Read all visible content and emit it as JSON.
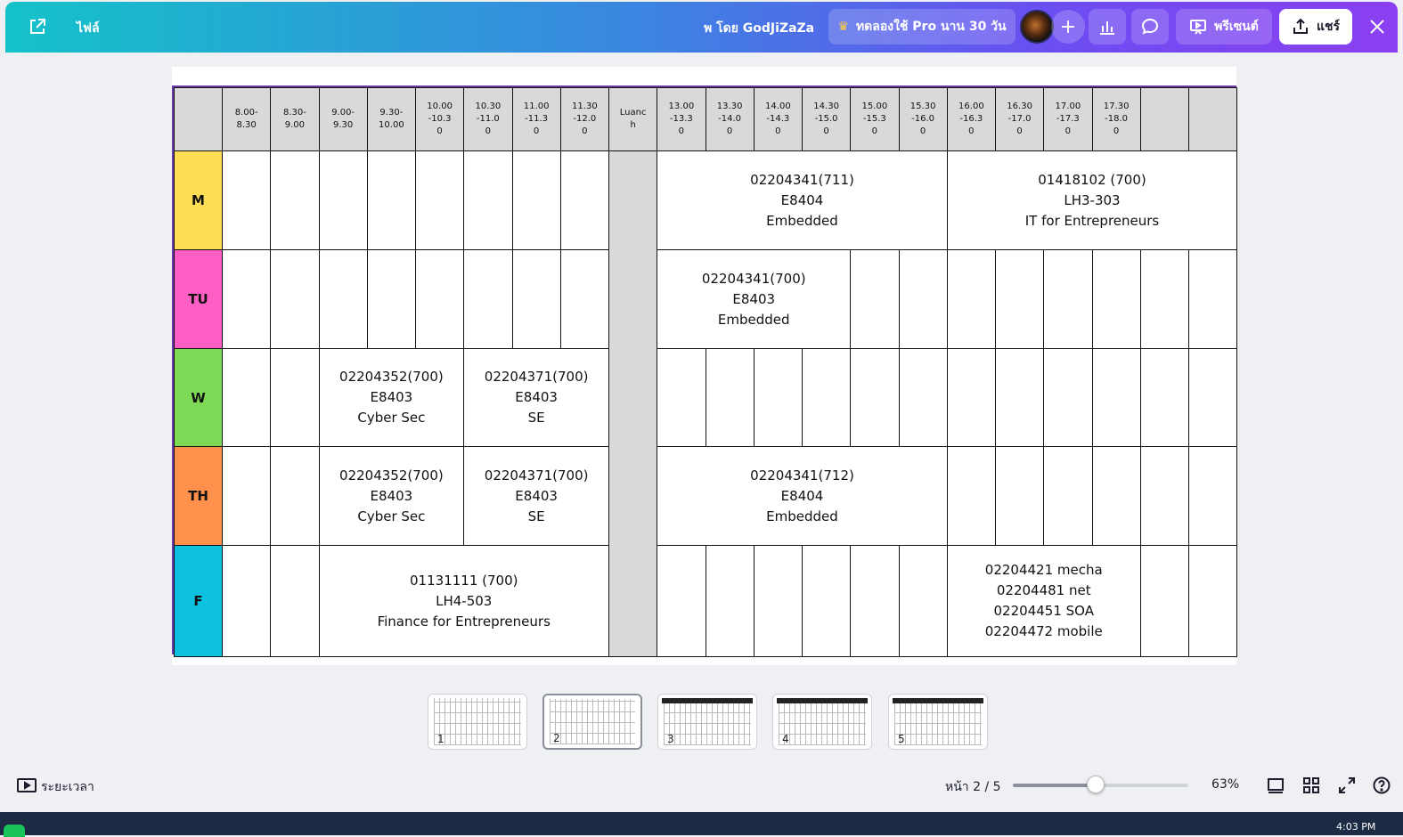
{
  "topbar": {
    "file_label": "ไฟล์",
    "owner_label": "พ โดย GodJiZaZa",
    "trial_label": "ทดลองใช้ Pro นาน 30 วัน",
    "present_label": "พรีเซนต์",
    "share_label": "แชร์",
    "colors": {
      "gradient_start": "#14c2c9",
      "gradient_end": "#8b3ff0"
    }
  },
  "schedule": {
    "corner": "",
    "time_slots": [
      "8.00-\n8.30",
      "8.30-\n9.00",
      "9.00-\n9.30",
      "9.30-\n10.00",
      "10.00\n-10.3\n0",
      "10.30\n-11.0\n0",
      "11.00\n-11.3\n0",
      "11.30\n-12.0\n0",
      "Luanc\nh",
      "13.00\n-13.3\n0",
      "13.30\n-14.0\n0",
      "14.00\n-14.3\n0",
      "14.30\n-15.0\n0",
      "15.00\n-15.3\n0",
      "15.30\n-16.0\n0",
      "16.00\n-16.3\n0",
      "16.30\n-17.0\n0",
      "17.00\n-17.3\n0",
      "17.30\n-18.0\n0",
      "",
      ""
    ],
    "days": [
      {
        "label": "M",
        "color": "#ffdd55"
      },
      {
        "label": "TU",
        "color": "#ff5fc4"
      },
      {
        "label": "W",
        "color": "#7ed957"
      },
      {
        "label": "TH",
        "color": "#ff914d"
      },
      {
        "label": "F",
        "color": "#0cc0df"
      }
    ],
    "courses": [
      {
        "day": 0,
        "start": 9,
        "span": 6,
        "lines": [
          "02204341(711)",
          "E8404",
          "Embedded"
        ]
      },
      {
        "day": 0,
        "start": 15,
        "span": 6,
        "lines": [
          "01418102 (700)",
          "LH3-303",
          "IT for Entrepreneurs"
        ]
      },
      {
        "day": 1,
        "start": 9,
        "span": 4,
        "lines": [
          "02204341(700)",
          "E8403",
          "Embedded"
        ]
      },
      {
        "day": 2,
        "start": 2,
        "span": 3,
        "lines": [
          "02204352(700)",
          "E8403",
          "Cyber Sec"
        ]
      },
      {
        "day": 2,
        "start": 5,
        "span": 3,
        "lines": [
          "02204371(700)",
          "E8403",
          "SE"
        ]
      },
      {
        "day": 3,
        "start": 2,
        "span": 3,
        "lines": [
          "02204352(700)",
          "E8403",
          "Cyber Sec"
        ]
      },
      {
        "day": 3,
        "start": 5,
        "span": 3,
        "lines": [
          "02204371(700)",
          "E8403",
          "SE"
        ]
      },
      {
        "day": 3,
        "start": 9,
        "span": 6,
        "lines": [
          "02204341(712)",
          "E8404",
          "Embedded"
        ]
      },
      {
        "day": 4,
        "start": 2,
        "span": 6,
        "lines": [
          "01131111 (700)",
          "LH4-503",
          "Finance for Entrepreneurs"
        ]
      },
      {
        "day": 4,
        "start": 15,
        "span": 4,
        "lines": [
          "02204421 mecha",
          "02204481 net",
          "02204451 SOA",
          "02204472  mobile"
        ]
      }
    ]
  },
  "thumbnails": [
    "1",
    "2",
    "3",
    "4",
    "5"
  ],
  "bottombar": {
    "timer_label": "ระยะเวลา",
    "page_label": "หน้า 2 / 5",
    "zoom_label": "63%",
    "zoom_fraction": 0.47
  },
  "taskbar": {
    "clock": "4:03 PM"
  }
}
